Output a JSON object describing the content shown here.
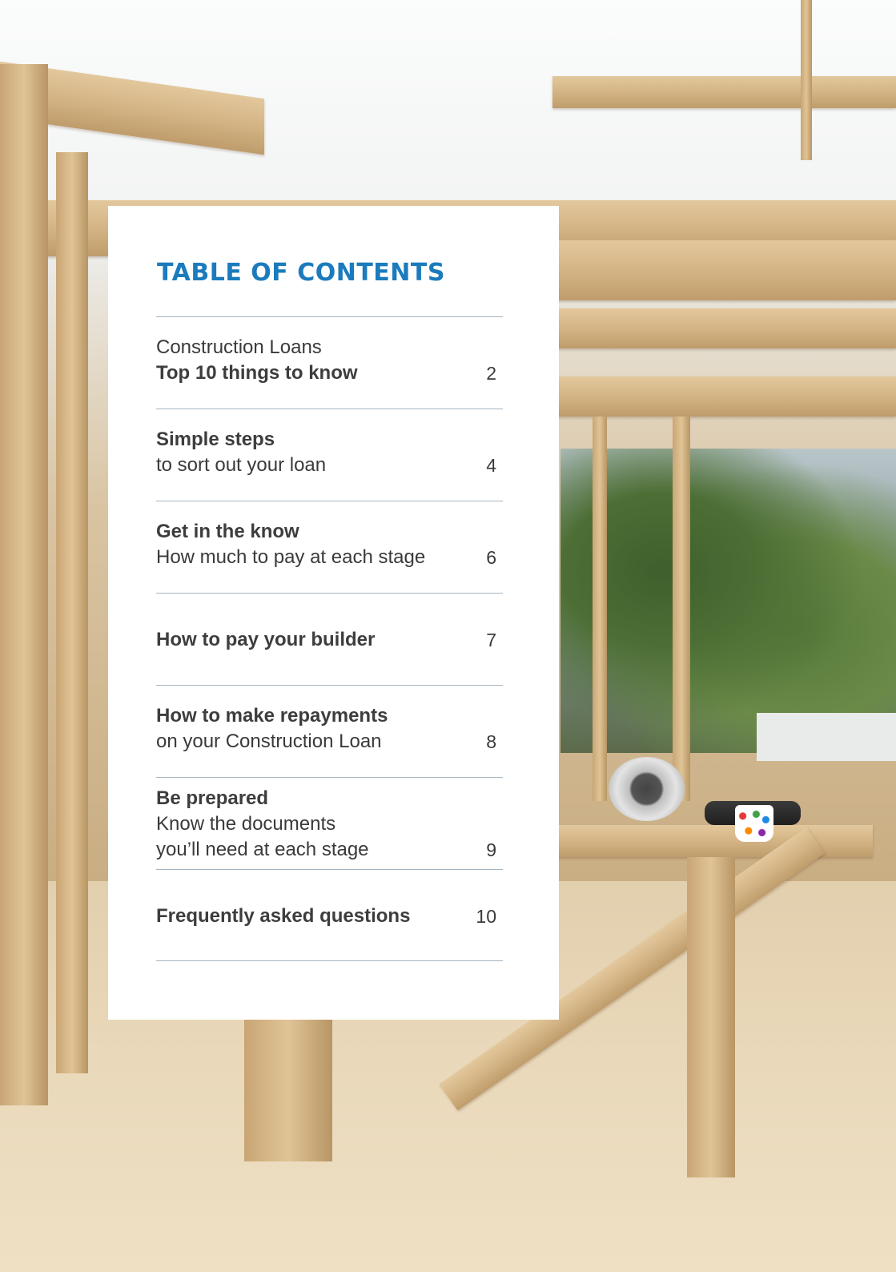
{
  "title": "TABLE OF CONTENTS",
  "entries": [
    {
      "lines": [
        "Construction Loans",
        "Top 10 things to know"
      ],
      "bold": [
        false,
        true
      ],
      "page": "2"
    },
    {
      "lines": [
        "Simple steps",
        "to sort out your loan"
      ],
      "bold": [
        true,
        false
      ],
      "page": "4"
    },
    {
      "lines": [
        "Get in the know",
        "How much to pay at each stage"
      ],
      "bold": [
        true,
        false
      ],
      "page": "6"
    },
    {
      "lines": [
        "How to pay your builder"
      ],
      "bold": [
        true
      ],
      "page": "7"
    },
    {
      "lines": [
        "How to make repayments",
        "on your Construction Loan"
      ],
      "bold": [
        true,
        false
      ],
      "page": "8"
    },
    {
      "lines": [
        "Be prepared",
        "Know the documents",
        "you’ll need at each stage"
      ],
      "bold": [
        true,
        false,
        false
      ],
      "page": "9"
    },
    {
      "lines": [
        "Frequently asked questions"
      ],
      "bold": [
        true
      ],
      "page": "10"
    }
  ],
  "colors": {
    "title": "#1b7bbd",
    "divider": "#a4b5c2",
    "text": "#3a3a3a",
    "panel": "#ffffff"
  }
}
